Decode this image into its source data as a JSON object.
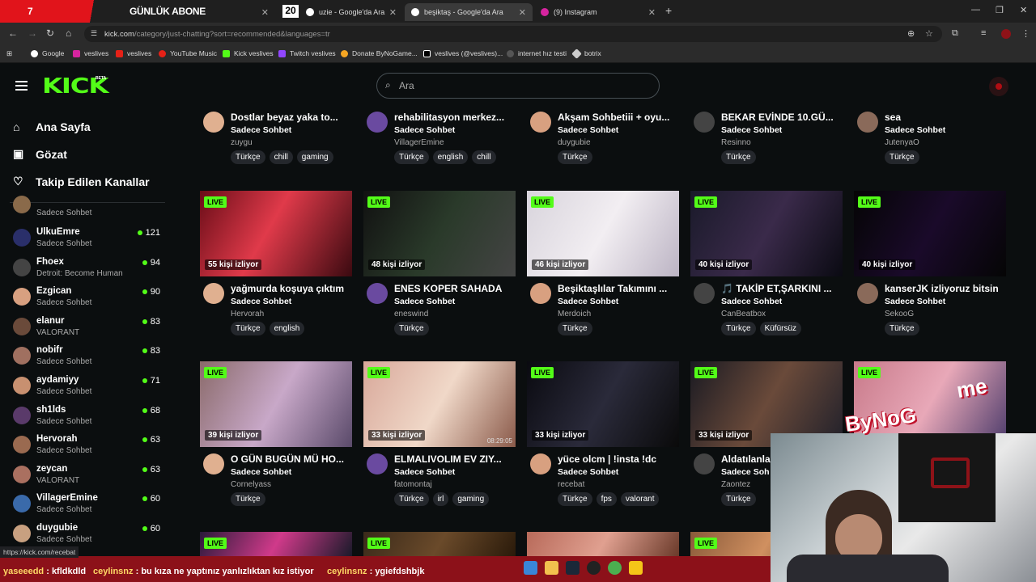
{
  "browser": {
    "tabs": [
      {
        "label": "GÜNLÜK ABONE",
        "overlay": "7"
      },
      {
        "label": "uzie - Google'da Ara",
        "overlay": "20"
      },
      {
        "label": "beşiktaş - Google'da Ara"
      },
      {
        "label": "(9) Instagram"
      }
    ],
    "url_host": "kick.com",
    "url_path": "/category/just-chatting?sort=recommended&languages=tr",
    "bookmarks": [
      "Google",
      "veslives",
      "veslives",
      "YouTube Music",
      "Kick veslives",
      "Twitch veslives",
      "Donate ByNoGame...",
      "veslives (@veslives)...",
      "internet hız testi",
      "botrix"
    ],
    "status_url": "https://kick.com/recebat"
  },
  "kick": {
    "logo": "KICK",
    "beta": "BETA",
    "search_placeholder": "Ara",
    "nav": [
      "Ana Sayfa",
      "Gözat",
      "Takip Edilen Kanallar"
    ]
  },
  "sidebar_channels": [
    {
      "name": "",
      "category": "Sadece Sohbet",
      "viewers": ""
    },
    {
      "name": "UlkuEmre",
      "category": "Sadece Sohbet",
      "viewers": "121"
    },
    {
      "name": "Fhoex",
      "category": "Detroit: Become Human",
      "viewers": "94"
    },
    {
      "name": "Ezgican",
      "category": "Sadece Sohbet",
      "viewers": "90"
    },
    {
      "name": "elanur",
      "category": "VALORANT",
      "viewers": "83"
    },
    {
      "name": "nobifr",
      "category": "Sadece Sohbet",
      "viewers": "83"
    },
    {
      "name": "aydamiyy",
      "category": "Sadece Sohbet",
      "viewers": "71"
    },
    {
      "name": "sh1lds",
      "category": "Sadece Sohbet",
      "viewers": "68"
    },
    {
      "name": "Hervorah",
      "category": "Sadece Sohbet",
      "viewers": "63"
    },
    {
      "name": "zeycan",
      "category": "VALORANT",
      "viewers": "63"
    },
    {
      "name": "VillagerEmine",
      "category": "Sadece Sohbet",
      "viewers": "60"
    },
    {
      "name": "duygubie",
      "category": "Sadece Sohbet",
      "viewers": "60"
    }
  ],
  "top_row": [
    {
      "title": "Dostlar beyaz yaka to...",
      "category": "Sadece Sohbet",
      "user": "zuygu",
      "tags": [
        "Türkçe",
        "chill",
        "gaming"
      ]
    },
    {
      "title": "rehabilitasyon merkez...",
      "category": "Sadece Sohbet",
      "user": "VillagerEmine",
      "tags": [
        "Türkçe",
        "english",
        "chill"
      ]
    },
    {
      "title": "Akşam Sohbetiii + oyu...",
      "category": "Sadece Sohbet",
      "user": "duygubie",
      "tags": [
        "Türkçe"
      ]
    },
    {
      "title": "BEKAR EVİNDE 10.GÜ...",
      "category": "Sadece Sohbet",
      "user": "Resinno",
      "tags": [
        "Türkçe"
      ]
    },
    {
      "title": "sea",
      "category": "Sadece Sohbet",
      "user": "JutenyaO",
      "tags": [
        "Türkçe"
      ]
    }
  ],
  "row2": [
    {
      "live": "LIVE",
      "viewers": "55 kişi izliyor",
      "title": "yağmurda koşuya çıktım",
      "category": "Sadece Sohbet",
      "user": "Hervorah",
      "tags": [
        "Türkçe",
        "english"
      ]
    },
    {
      "live": "LIVE",
      "viewers": "48 kişi izliyor",
      "title": "ENES KOPER SAHADA",
      "category": "Sadece Sohbet",
      "user": "eneswind",
      "tags": [
        "Türkçe"
      ]
    },
    {
      "live": "LIVE",
      "viewers": "46 kişi izliyor",
      "title": "Beşiktaşlılar Takımını ...",
      "category": "Sadece Sohbet",
      "user": "Merdoich",
      "tags": [
        "Türkçe"
      ]
    },
    {
      "live": "LIVE",
      "viewers": "40 kişi izliyor",
      "title": "🎵 TAKİP ET,ŞARKINI ...",
      "category": "Sadece Sohbet",
      "user": "CanBeatbox",
      "tags": [
        "Türkçe",
        "Küfürsüz"
      ]
    },
    {
      "live": "LIVE",
      "viewers": "40 kişi izliyor",
      "title": "kanserJK izliyoruz bitsin",
      "category": "Sadece Sohbet",
      "user": "SekooG",
      "tags": [
        "Türkçe"
      ]
    }
  ],
  "row3": [
    {
      "live": "LIVE",
      "viewers": "39 kişi izliyor",
      "title": "O GÜN BUGÜN MÜ HO...",
      "category": "Sadece Sohbet",
      "user": "Cornelyass",
      "tags": [
        "Türkçe"
      ]
    },
    {
      "live": "LIVE",
      "viewers": "33 kişi izliyor",
      "title": "ELMALIVOLIM EV ZIY...",
      "category": "Sadece Sohbet",
      "user": "fatomontaj",
      "tags": [
        "Türkçe",
        "irl",
        "gaming"
      ]
    },
    {
      "live": "LIVE",
      "viewers": "33 kişi izliyor",
      "title": "yüce olcm | !insta !dc",
      "category": "Sadece Sohbet",
      "user": "recebat",
      "tags": [
        "Türkçe",
        "fps",
        "valorant"
      ]
    },
    {
      "live": "LIVE",
      "viewers": "33 kişi izliyor",
      "title": "Aldatılanlar",
      "category": "Sadece Soh",
      "user": "Zaontez",
      "tags": [
        "Türkçe"
      ]
    },
    {
      "live": "LIVE",
      "viewers": "",
      "title": "",
      "category": "",
      "user": "",
      "tags": []
    }
  ],
  "row4": [
    {
      "live": "LIVE"
    },
    {
      "live": "LIVE"
    },
    {
      "live": ""
    },
    {
      "live": "LIVE"
    }
  ],
  "overlay_text": {
    "bynog": "ByNoG",
    "bynog_m": "me",
    "timestamp": "08:29:05"
  },
  "chat": [
    {
      "user": "yaseeedd",
      "msg": ": kfldkdld"
    },
    {
      "user": "ceylinsnz",
      "msg": ": bu kıza ne yaptınız yanlızlıktan kız istiyor"
    },
    {
      "user": "ceylinsnz",
      "msg": ": ygiefdshbjk"
    }
  ],
  "colors": {
    "accent": "#53fc18",
    "bg": "#0b0e0f",
    "chat_bg": "#8c1119"
  }
}
